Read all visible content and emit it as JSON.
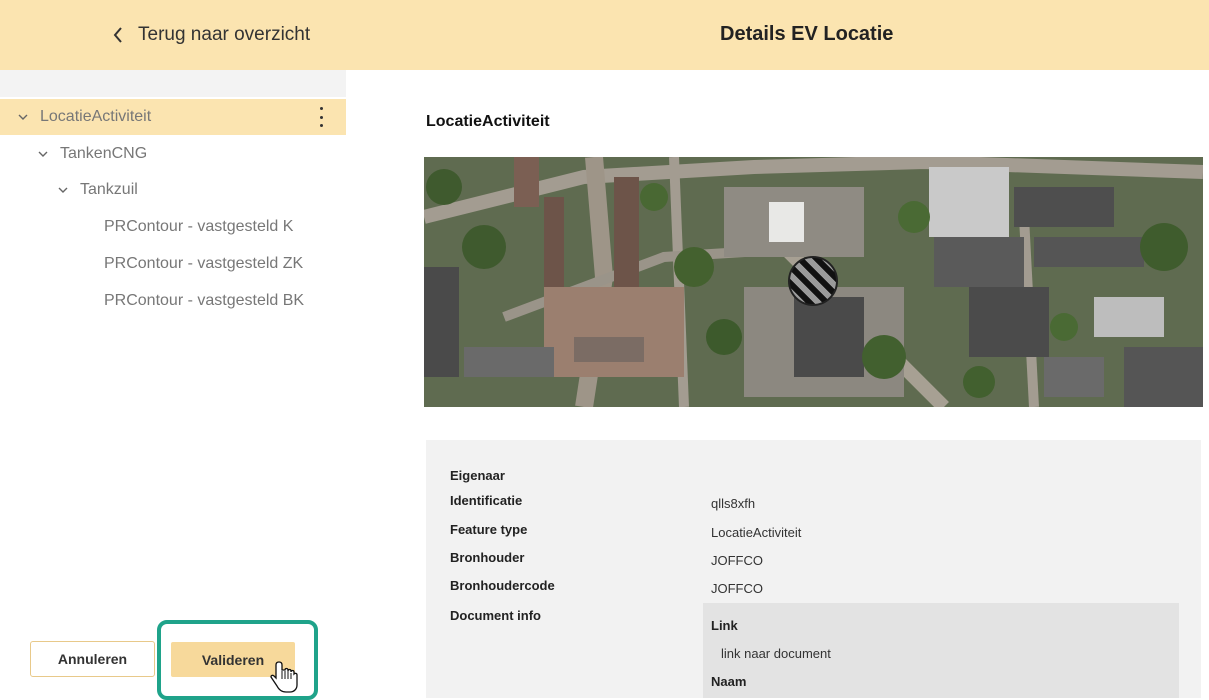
{
  "header": {
    "back_label": "Terug naar overzicht",
    "title": "Details EV Locatie"
  },
  "tree": {
    "items": [
      {
        "label": "LocatieActiviteit",
        "level": 0,
        "expanded": true,
        "selected": true
      },
      {
        "label": "TankenCNG",
        "level": 1,
        "expanded": true
      },
      {
        "label": "Tankzuil",
        "level": 2,
        "expanded": true
      },
      {
        "label": "PRContour - vastgesteld K",
        "level": 3
      },
      {
        "label": "PRContour - vastgesteld ZK",
        "level": 3
      },
      {
        "label": "PRContour - vastgesteld BK",
        "level": 3
      }
    ]
  },
  "actions": {
    "cancel_label": "Annuleren",
    "validate_label": "Valideren"
  },
  "main": {
    "section_title": "LocatieActiviteit",
    "fields": [
      {
        "label": "Eigenaar",
        "value": ""
      },
      {
        "label": "Identificatie",
        "value": "qlls8xfh"
      },
      {
        "label": "Feature type",
        "value": "LocatieActiviteit"
      },
      {
        "label": "Bronhouder",
        "value": "JOFFCO"
      },
      {
        "label": "Bronhoudercode",
        "value": "JOFFCO"
      },
      {
        "label": "Document info",
        "value": ""
      }
    ],
    "document": {
      "link_label": "Link",
      "link_text": "link naar document",
      "name_label": "Naam"
    }
  },
  "colors": {
    "header_bg": "#fbe4b0",
    "selected_bg": "#fbe4b0",
    "validate_bg": "#f7d99b",
    "highlight": "#1fa38a"
  }
}
